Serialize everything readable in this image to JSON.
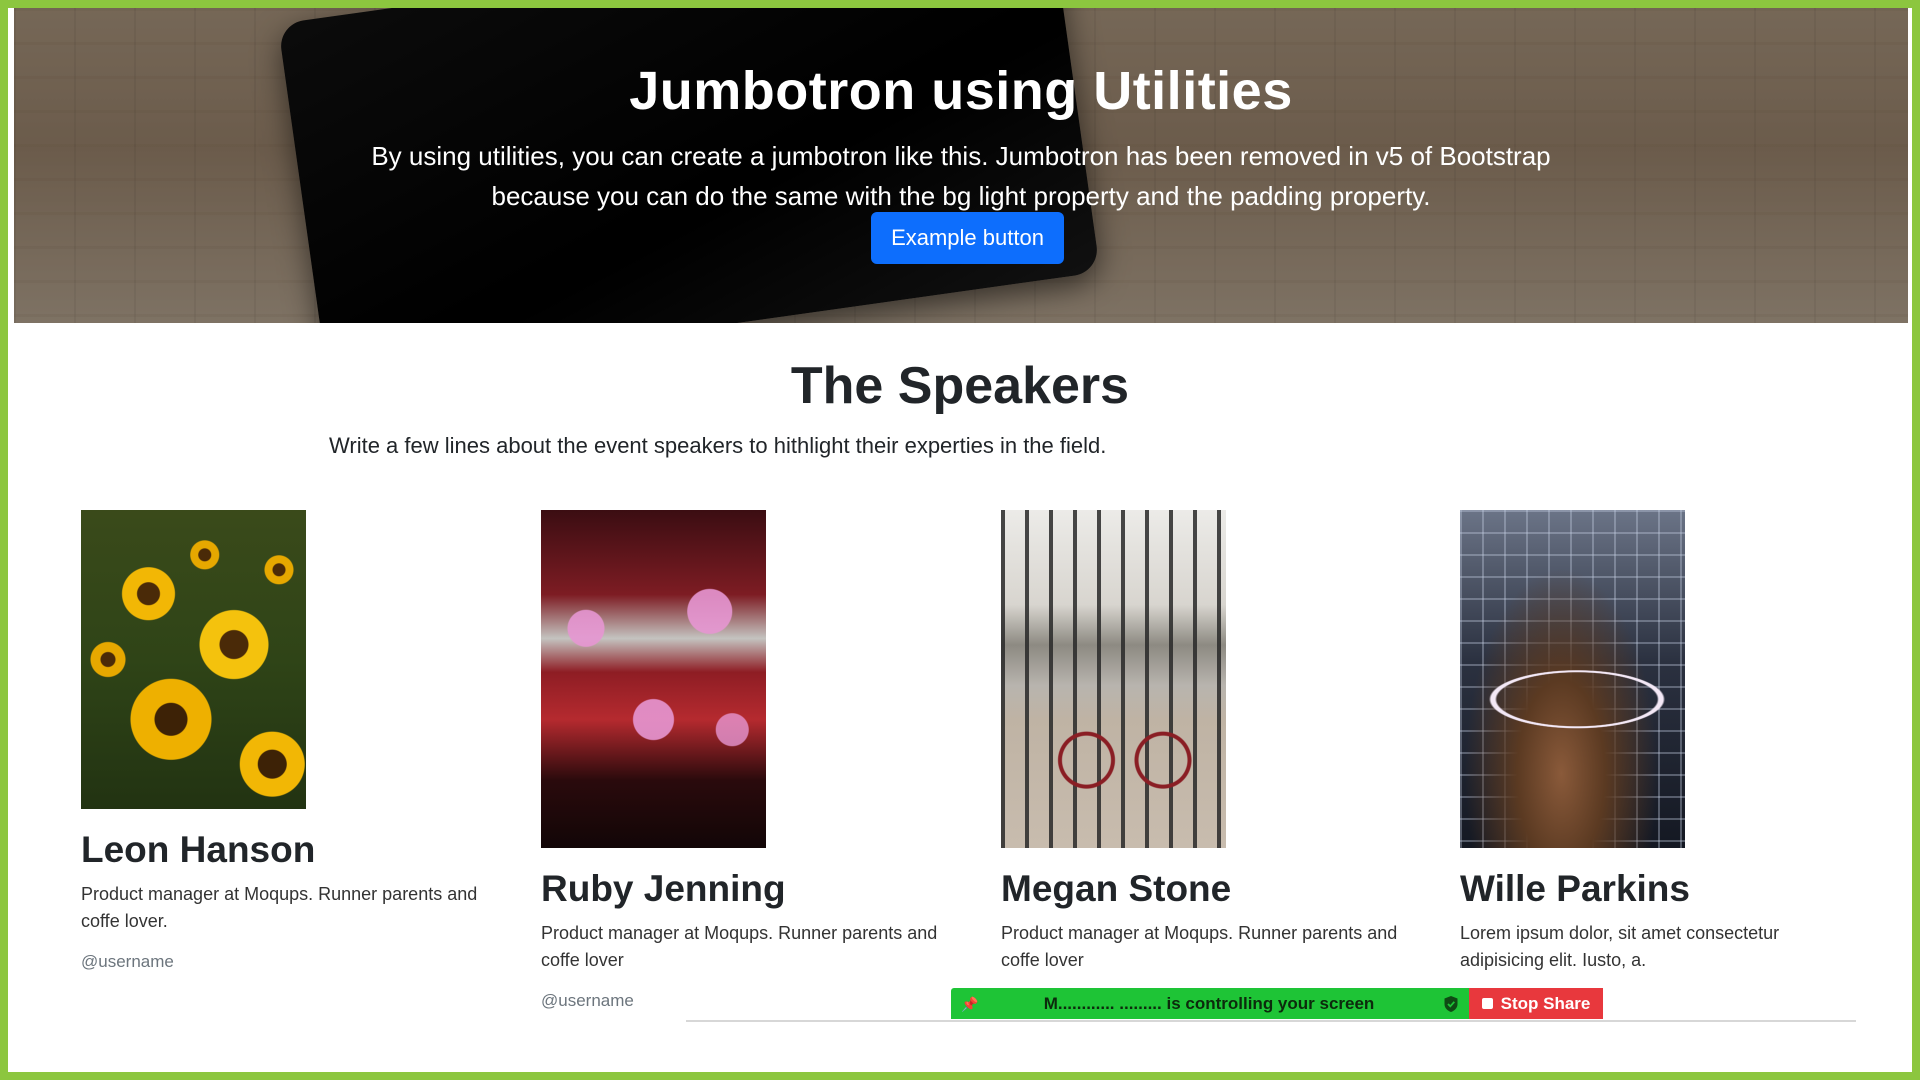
{
  "hero": {
    "title": "Jumbotron using Utilities",
    "lead": "By using utilities, you can create a jumbotron like this. Jumbotron has been removed in v5 of Bootstrap because you can do the same with the bg light property and the padding property.",
    "button_label": "Example button"
  },
  "speakers": {
    "title": "The Speakers",
    "subtitle": "Write a few lines about the event speakers to hithlight their experties in the field.",
    "cards": [
      {
        "name": "Leon Hanson",
        "bio": "Product manager at Moqups. Runner parents and coffe lover.",
        "handle": "@username",
        "photo": "sunflower-field-photo"
      },
      {
        "name": "Ruby Jenning",
        "bio": "Product manager at Moqups. Runner parents and coffe lover",
        "handle": "@username",
        "photo": "temple-blossoms-photo"
      },
      {
        "name": "Megan Stone",
        "bio": "Product manager at Moqups. Runner parents and coffe lover",
        "handle": "",
        "photo": "bicycle-by-lake-photo"
      },
      {
        "name": "Wille Parkins",
        "bio": "Lorem ipsum dolor, sit amet consectetur adipisicing elit. Iusto, a.",
        "handle": "",
        "photo": "glass-dome-garden-photo"
      }
    ]
  },
  "share_bar": {
    "message": "M............ ......... is controlling your screen",
    "stop_label": "Stop Share",
    "bar_color": "#1ec436",
    "stop_color": "#e8383d"
  },
  "colors": {
    "frame_border": "#8cc63f",
    "primary_button": "#0d6efd"
  }
}
